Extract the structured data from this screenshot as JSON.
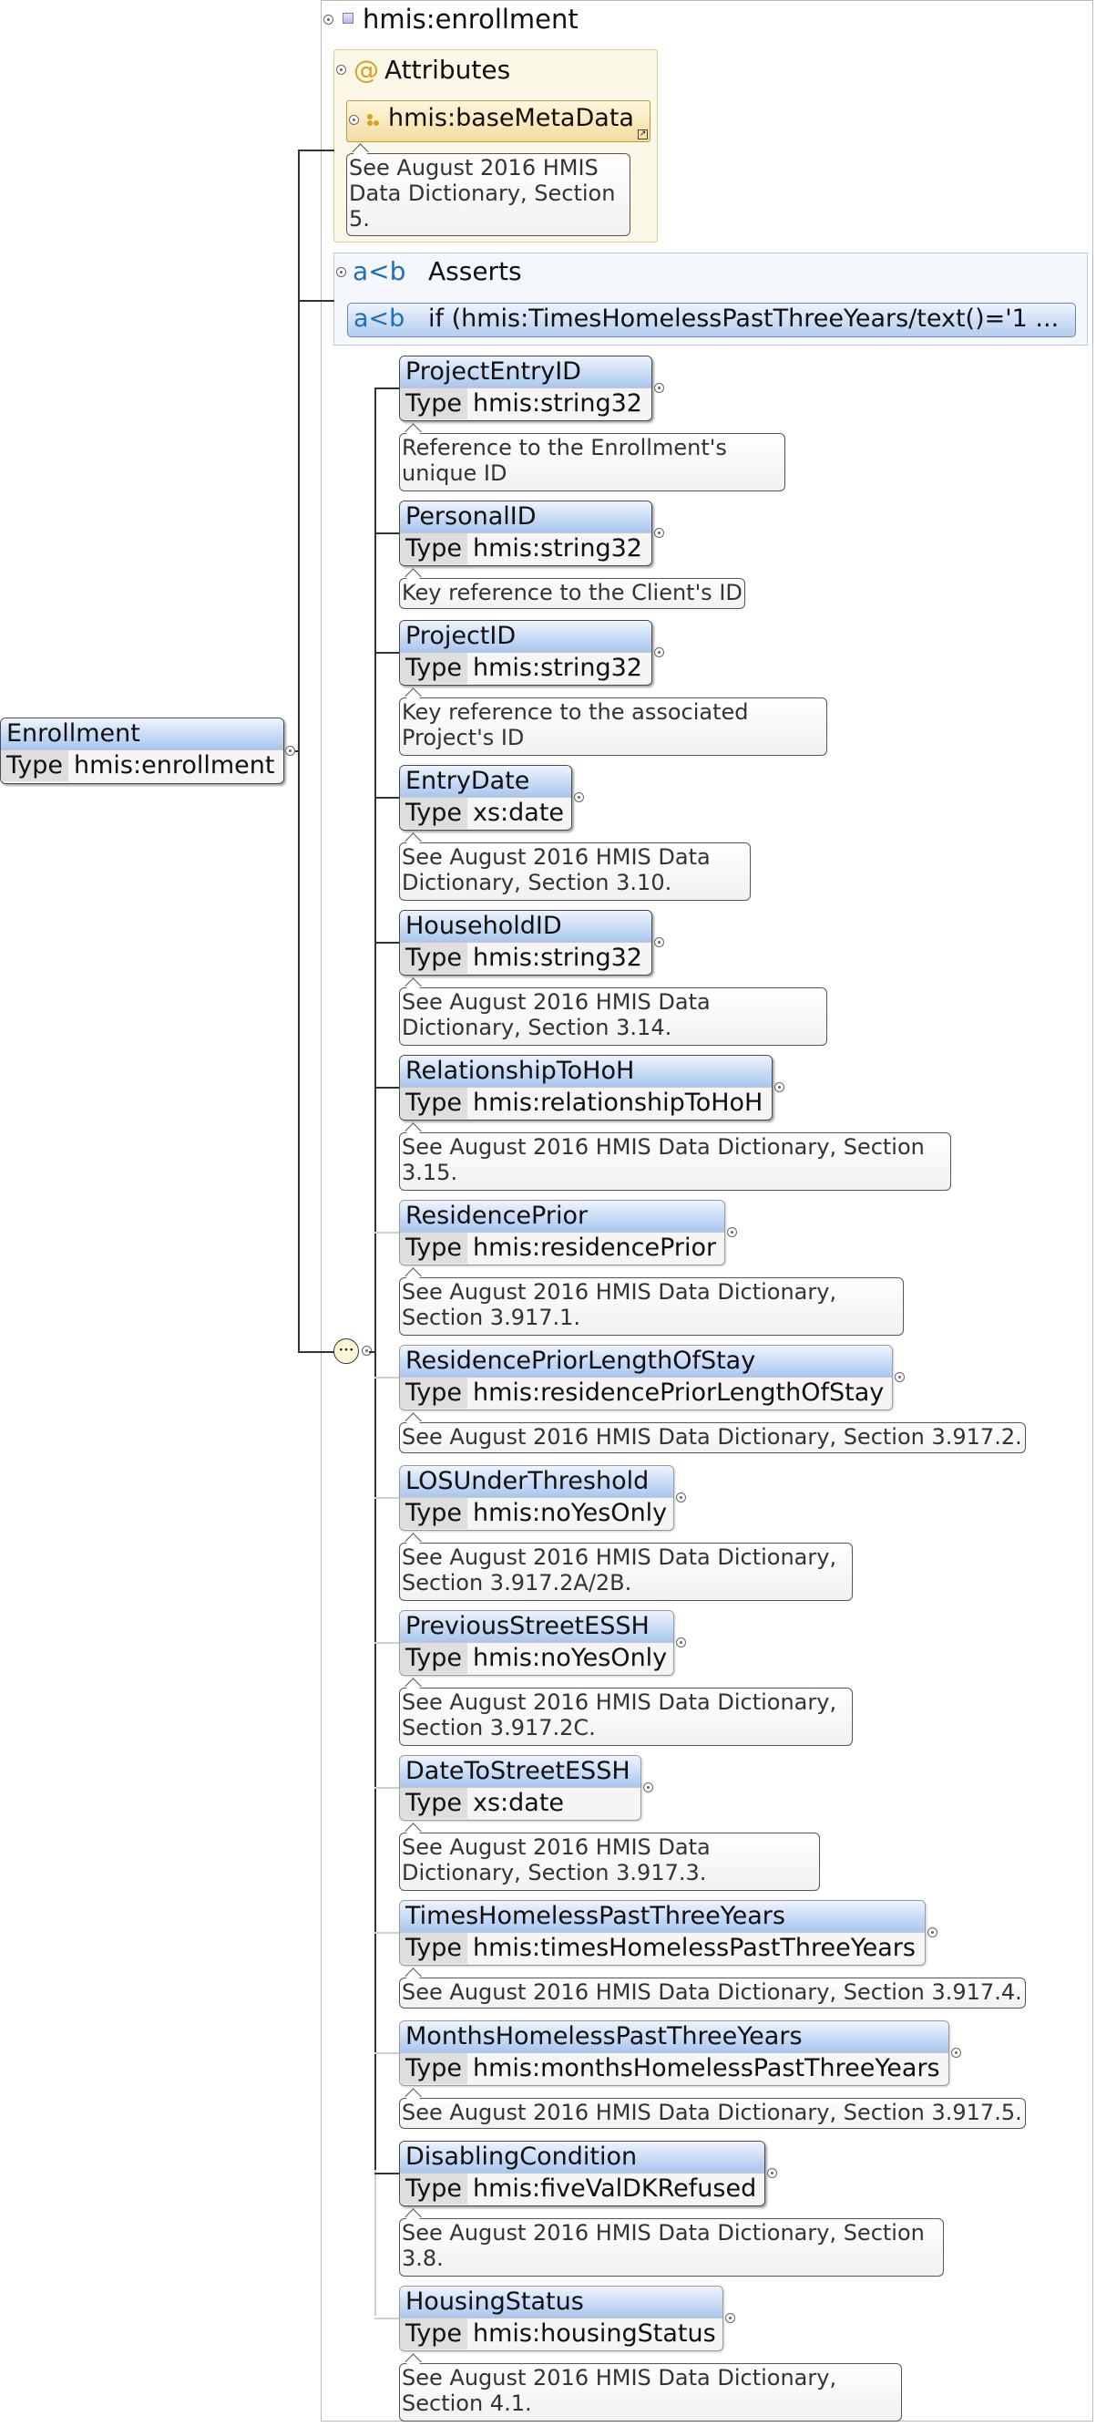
{
  "root": {
    "name": "Enrollment",
    "type_label": "Type",
    "type": "hmis:enrollment"
  },
  "complex_type": {
    "title": "hmis:enrollment"
  },
  "attributes": {
    "label": "Attributes",
    "icon": "@",
    "item": {
      "name": "hmis:baseMetaData"
    },
    "doc": "See August 2016 HMIS Data Dictionary, Section 5."
  },
  "asserts": {
    "label": "Asserts",
    "icon": "a<b",
    "item_icon": "a<b",
    "item_text": "if (hmis:TimesHomelessPastThreeYears/text()='1 ..."
  },
  "elements": [
    {
      "name": "ProjectEntryID",
      "type": "hmis:string32",
      "doc": "Reference to the Enrollment's unique ID"
    },
    {
      "name": "PersonalID",
      "type": "hmis:string32",
      "doc": "Key reference to the Client's ID"
    },
    {
      "name": "ProjectID",
      "type": "hmis:string32",
      "doc": "Key reference to the associated Project's ID"
    },
    {
      "name": "EntryDate",
      "type": "xs:date",
      "doc": "See August 2016 HMIS Data Dictionary, Section 3.10."
    },
    {
      "name": "HouseholdID",
      "type": "hmis:string32",
      "doc": "See August 2016 HMIS Data Dictionary, Section 3.14."
    },
    {
      "name": "RelationshipToHoH",
      "type": "hmis:relationshipToHoH",
      "doc": "See August 2016 HMIS Data Dictionary, Section 3.15."
    },
    {
      "name": "ResidencePrior",
      "type": "hmis:residencePrior",
      "doc": "See August 2016 HMIS Data Dictionary, Section 3.917.1."
    },
    {
      "name": "ResidencePriorLengthOfStay",
      "type": "hmis:residencePriorLengthOfStay",
      "doc": "See August 2016 HMIS Data Dictionary, Section 3.917.2."
    },
    {
      "name": "LOSUnderThreshold",
      "type": "hmis:noYesOnly",
      "doc": "See August 2016 HMIS Data Dictionary, Section 3.917.2A/2B."
    },
    {
      "name": "PreviousStreetESSH",
      "type": "hmis:noYesOnly",
      "doc": "See August 2016 HMIS Data Dictionary, Section 3.917.2C."
    },
    {
      "name": "DateToStreetESSH",
      "type": "xs:date",
      "doc": "See August 2016 HMIS Data Dictionary, Section 3.917.3."
    },
    {
      "name": "TimesHomelessPastThreeYears",
      "type": "hmis:timesHomelessPastThreeYears",
      "doc": "See August 2016 HMIS Data Dictionary, Section 3.917.4."
    },
    {
      "name": "MonthsHomelessPastThreeYears",
      "type": "hmis:monthsHomelessPastThreeYears",
      "doc": "See August 2016 HMIS Data Dictionary, Section 3.917.5."
    },
    {
      "name": "DisablingCondition",
      "type": "hmis:fiveValDKRefused",
      "doc": "See August 2016 HMIS Data Dictionary, Section 3.8."
    },
    {
      "name": "HousingStatus",
      "type": "hmis:housingStatus",
      "doc": "See August 2016 HMIS Data Dictionary, Section 4.1."
    }
  ],
  "type_label": "Type",
  "colors": {
    "node_header": "#a9c6ef",
    "attr_bg": "#fcf8e8",
    "assert_bg": "#f4f7fc",
    "assert_icon": "#1f6fb8",
    "attr_icon": "#d9a21b"
  }
}
